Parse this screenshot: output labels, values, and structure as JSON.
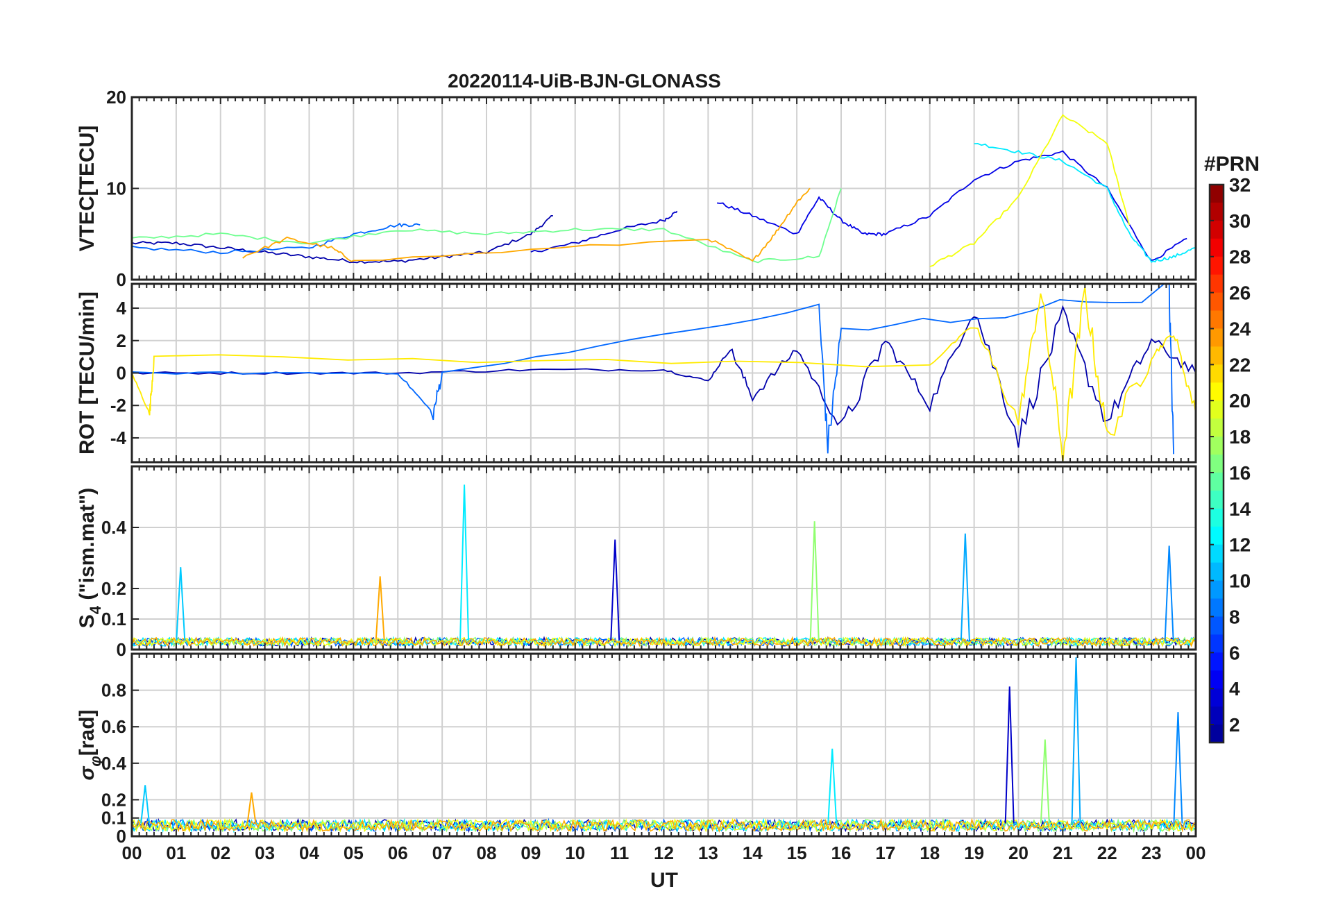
{
  "title": "20220114-UiB-BJN-GLONASS",
  "colorbar": {
    "label": "#PRN",
    "ticks": [
      "32",
      "30",
      "28",
      "26",
      "24",
      "22",
      "20",
      "18",
      "16",
      "14",
      "12",
      "10",
      "8",
      "6",
      "4",
      "2"
    ],
    "range": [
      1,
      32
    ],
    "colormap": [
      "#00008f",
      "#0000ff",
      "#0080ff",
      "#00ffff",
      "#80ff80",
      "#ffff00",
      "#ff8000",
      "#ff0000",
      "#800000"
    ]
  },
  "xaxis": {
    "label": "UT",
    "ticks": [
      "00",
      "01",
      "02",
      "03",
      "04",
      "05",
      "06",
      "07",
      "08",
      "09",
      "10",
      "11",
      "12",
      "13",
      "14",
      "15",
      "16",
      "17",
      "18",
      "19",
      "20",
      "21",
      "22",
      "23",
      "00"
    ],
    "range_hours": [
      0,
      24
    ]
  },
  "panels": [
    {
      "ylabel": "VTEC[TECU]",
      "ylim": [
        0,
        20
      ],
      "ytick_labels": [
        "0",
        "10",
        "20"
      ],
      "ytick_values": [
        0,
        10,
        20
      ]
    },
    {
      "ylabel": "ROT [TECU/min]",
      "ylim": [
        -5.5,
        5.5
      ],
      "ytick_labels": [
        "-4",
        "-2",
        "0",
        "2",
        "4"
      ],
      "ytick_values": [
        -4,
        -2,
        0,
        2,
        4
      ]
    },
    {
      "ylabel": "S",
      "ylabel_sub": "4",
      "ylabel_tail": " (\"ism.mat\")",
      "ylim": [
        0,
        0.6
      ],
      "ytick_labels": [
        "0",
        "0.1",
        "0.2",
        "0.4"
      ],
      "ytick_values": [
        0,
        0.1,
        0.2,
        0.4
      ]
    },
    {
      "ylabel": "σ",
      "ylabel_sub": "φ",
      "ylabel_tail": "[rad]",
      "ylim": [
        0,
        1.0
      ],
      "ytick_labels": [
        "0",
        "0.1",
        "0.2",
        "0.4",
        "0.6",
        "0.8"
      ],
      "ytick_values": [
        0,
        0.1,
        0.2,
        0.4,
        0.6,
        0.8
      ]
    }
  ],
  "chart_data": [
    {
      "type": "line",
      "title": "20220114-UiB-BJN-GLONASS",
      "xlabel": "UT",
      "ylabel": "VTEC[TECU]",
      "xlim": [
        0,
        24
      ],
      "ylim": [
        0,
        20
      ],
      "grid": true,
      "series": [
        {
          "name": "2",
          "x": [
            0,
            1,
            2,
            3,
            4,
            5,
            6,
            7,
            8,
            9,
            9.5
          ],
          "values": [
            4.0,
            4.0,
            3.5,
            3.0,
            2.5,
            2.0,
            2.0,
            2.5,
            3.0,
            5.0,
            7.0
          ]
        },
        {
          "name": "3",
          "x": [
            9,
            10,
            11,
            12,
            12.3
          ],
          "values": [
            3.0,
            4.0,
            5.5,
            6.5,
            7.5
          ]
        },
        {
          "name": "4",
          "x": [
            13.2,
            14,
            15,
            15.5,
            16,
            16.5,
            17,
            18,
            19,
            20,
            21,
            22,
            23,
            23.8
          ],
          "values": [
            8.5,
            7.0,
            5.0,
            9.0,
            6.5,
            5.0,
            5.0,
            7.0,
            11.0,
            13.0,
            14.0,
            10.0,
            2.0,
            4.5
          ]
        },
        {
          "name": "8",
          "x": [
            0,
            2,
            4,
            5,
            6,
            6.5
          ],
          "values": [
            3.5,
            3.0,
            3.5,
            5.0,
            6.0,
            6.0
          ]
        },
        {
          "name": "12",
          "x": [
            19,
            20,
            21,
            22,
            22.5,
            23,
            23.5,
            24
          ],
          "values": [
            15.0,
            14.0,
            13.0,
            10.0,
            5.0,
            2.0,
            2.5,
            3.5
          ]
        },
        {
          "name": "16",
          "x": [
            0,
            2,
            4,
            6,
            8,
            10,
            12,
            14,
            15.5,
            16
          ],
          "values": [
            4.5,
            5.0,
            4.0,
            5.5,
            5.0,
            5.5,
            5.5,
            2.0,
            2.5,
            10.0
          ]
        },
        {
          "name": "20",
          "x": [
            18,
            19,
            20,
            21,
            22,
            22.5
          ],
          "values": [
            1.5,
            4.0,
            9.0,
            18.0,
            15.0,
            6.0
          ]
        },
        {
          "name": "23",
          "x": [
            2.5,
            3.5,
            4.5,
            5.0,
            13,
            14,
            14.5,
            15,
            15.3
          ],
          "values": [
            2.5,
            4.5,
            3.5,
            2.0,
            4.5,
            2.0,
            5.0,
            8.5,
            10.0
          ]
        }
      ]
    },
    {
      "type": "line",
      "xlabel": "UT",
      "ylabel": "ROT [TECU/min]",
      "xlim": [
        0,
        24
      ],
      "ylim": [
        -5.5,
        5.5
      ],
      "grid": true,
      "series": [
        {
          "name": "2",
          "x": [
            0,
            3,
            6,
            9,
            12,
            13,
            13.5,
            14,
            15,
            16,
            17,
            18,
            19,
            20,
            21,
            22,
            23,
            24
          ],
          "values": [
            0.0,
            0.0,
            0.0,
            0.2,
            0.2,
            -0.5,
            1.5,
            -1.5,
            1.5,
            -3.5,
            2.0,
            -2.0,
            4.0,
            -4.0,
            3.5,
            -3.0,
            2.0,
            0.0
          ]
        },
        {
          "name": "8",
          "x": [
            0,
            6,
            6.8,
            7,
            15.5,
            15.7,
            16,
            23.4,
            23.5
          ],
          "values": [
            0.0,
            0.0,
            -2.5,
            0.0,
            4.0,
            -4.5,
            2.5,
            5.0,
            -5.0
          ]
        },
        {
          "name": "21",
          "x": [
            0,
            0.4,
            0.5,
            18,
            19,
            20,
            20.5,
            21,
            21.5,
            22,
            23,
            23.5,
            24
          ],
          "values": [
            0.0,
            -2.5,
            1.0,
            0.5,
            3.0,
            -3.0,
            5.0,
            -5.0,
            5.0,
            -4.0,
            1.0,
            2.5,
            -2.5
          ]
        }
      ]
    },
    {
      "type": "line",
      "xlabel": "UT",
      "ylabel": "S4 (\"ism.mat\")",
      "xlim": [
        0,
        24
      ],
      "ylim": [
        0,
        0.6
      ],
      "grid": true,
      "peaks": [
        {
          "x": 1.1,
          "value": 0.27
        },
        {
          "x": 5.6,
          "value": 0.24
        },
        {
          "x": 7.5,
          "value": 0.54
        },
        {
          "x": 10.9,
          "value": 0.36
        },
        {
          "x": 15.4,
          "value": 0.42
        },
        {
          "x": 18.8,
          "value": 0.38
        },
        {
          "x": 23.4,
          "value": 0.34
        }
      ],
      "baseline": 0.03
    },
    {
      "type": "line",
      "xlabel": "UT",
      "ylabel": "σφ[rad]",
      "xlim": [
        0,
        24
      ],
      "ylim": [
        0,
        1.0
      ],
      "grid": true,
      "peaks": [
        {
          "x": 0.3,
          "value": 0.28
        },
        {
          "x": 2.7,
          "value": 0.24
        },
        {
          "x": 15.8,
          "value": 0.48
        },
        {
          "x": 19.8,
          "value": 0.82
        },
        {
          "x": 20.6,
          "value": 0.53
        },
        {
          "x": 21.3,
          "value": 0.98
        },
        {
          "x": 23.6,
          "value": 0.68
        }
      ],
      "baseline": 0.07
    }
  ]
}
